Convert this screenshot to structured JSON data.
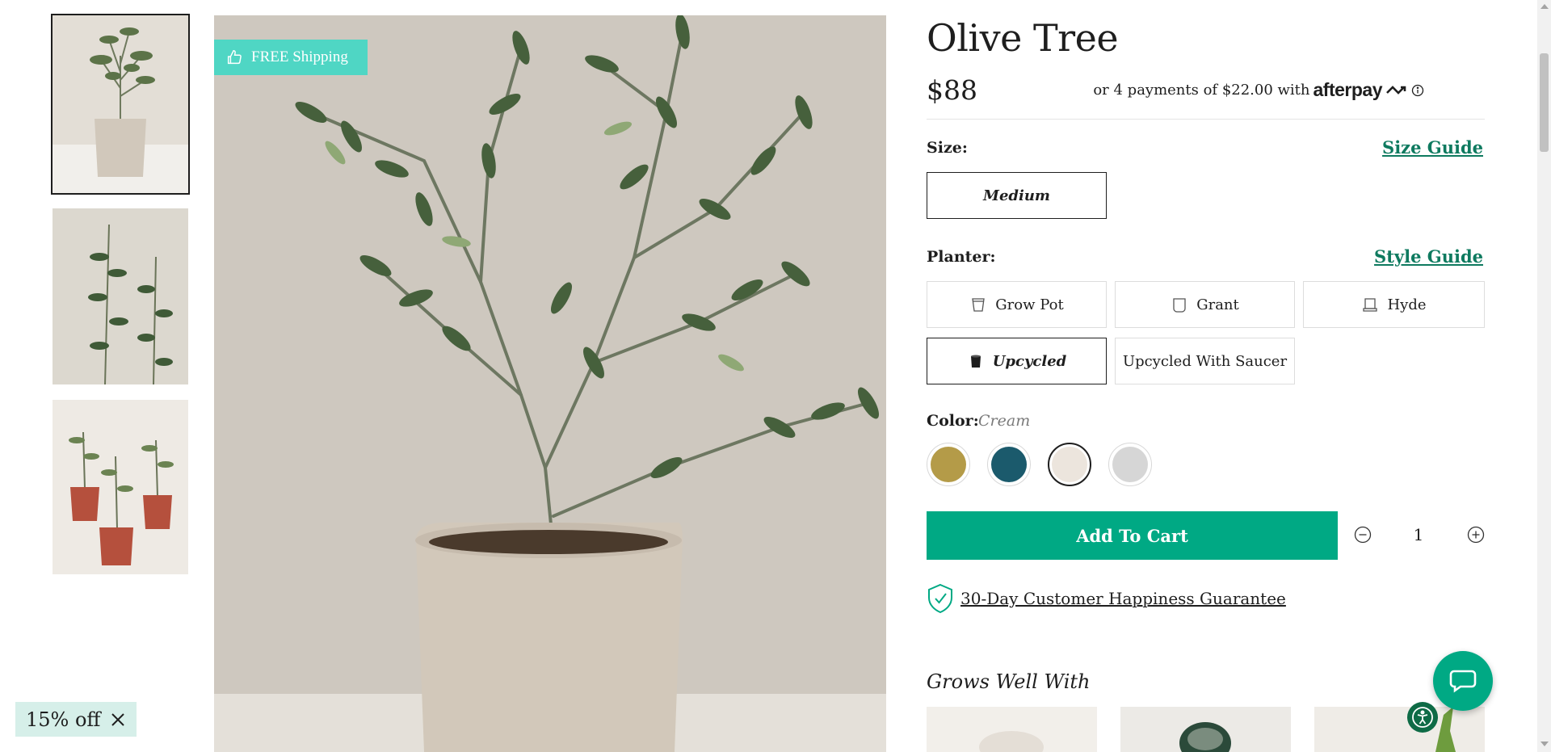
{
  "product": {
    "title": "Olive Tree",
    "price": "$88",
    "afterpay_text": "or 4 payments of $22.00 with",
    "afterpay_brand": "afterpay"
  },
  "badge": {
    "free_shipping": "FREE Shipping"
  },
  "size": {
    "label": "Size:",
    "guide_link": "Size Guide",
    "options": [
      "Medium"
    ],
    "selected": "Medium"
  },
  "planter": {
    "label": "Planter:",
    "guide_link": "Style Guide",
    "options": [
      "Grow Pot",
      "Grant",
      "Hyde",
      "Upcycled",
      "Upcycled With Saucer"
    ],
    "selected": "Upcycled"
  },
  "color": {
    "label": "Color:",
    "selected_name": "Cream",
    "swatches": [
      {
        "name": "Mustard",
        "hex": "#b49b48"
      },
      {
        "name": "Blue",
        "hex": "#1b5a6c"
      },
      {
        "name": "Cream",
        "hex": "#ece5dd"
      },
      {
        "name": "Gray",
        "hex": "#d6d6d6"
      }
    ]
  },
  "cart": {
    "add_label": "Add To Cart",
    "quantity": "1",
    "accent": "#00a984"
  },
  "guarantee": {
    "text": "30-Day Customer Happiness Guarantee"
  },
  "grows_well": {
    "title": "Grows Well With"
  },
  "discount": {
    "label": "15% off"
  },
  "icons": [
    "thumbs-up-icon",
    "grow-pot-icon",
    "grant-planter-icon",
    "hyde-planter-icon",
    "upcycled-planter-icon",
    "info-icon",
    "minus-icon",
    "plus-icon",
    "shield-check-icon",
    "chat-icon",
    "accessibility-icon",
    "close-icon"
  ]
}
